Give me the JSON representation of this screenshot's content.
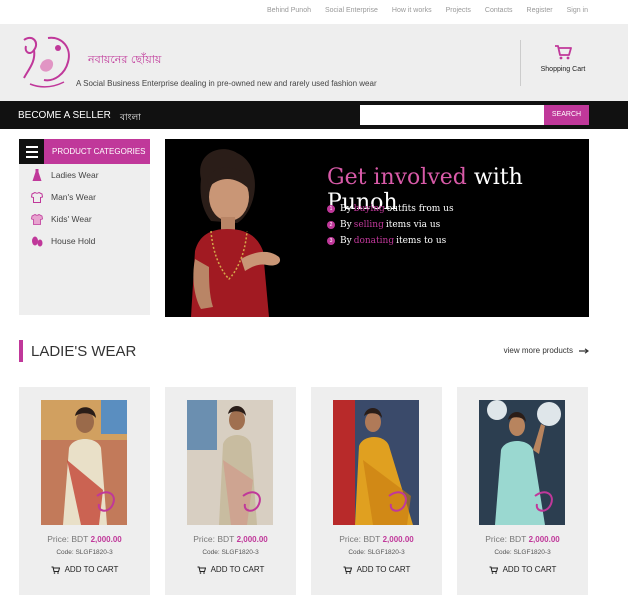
{
  "topnav": [
    "Behind Punoh",
    "Social Enterprise",
    "How it works",
    "Projects",
    "Contacts",
    "Register",
    "Sign in"
  ],
  "header": {
    "logo_text": "নবায়নের ছোঁয়ায়",
    "tagline": "A Social Business Enterprise dealing in pre-owned new and rarely used fashion wear",
    "cart_label": "Shopping Cart"
  },
  "bar": {
    "seller": "BECOME A SELLER",
    "language": "বাংলা",
    "search_value": "",
    "search_button": "SEARCH"
  },
  "categories": {
    "title": "PRODUCT CATEGORIES",
    "items": [
      {
        "label": "Ladies Wear",
        "icon": "dress-icon"
      },
      {
        "label": "Man's Wear",
        "icon": "shirt-icon"
      },
      {
        "label": "Kids' Wear",
        "icon": "kids-shirt-icon"
      },
      {
        "label": "House Hold",
        "icon": "household-icon"
      }
    ]
  },
  "banner": {
    "headline_a": "Get involved",
    "headline_b": "with Punoh",
    "points": [
      {
        "num": "1",
        "pre": "By",
        "hl": "buying",
        "post": "outfits from us"
      },
      {
        "num": "2",
        "pre": "By",
        "hl": "selling",
        "post": "items via us"
      },
      {
        "num": "3",
        "pre": "By",
        "hl": "donating",
        "post": "items to us"
      }
    ]
  },
  "section": {
    "title": "LADIE'S WEAR",
    "more": "view more products"
  },
  "products": [
    {
      "price_label": "Price: BDT",
      "price": "2,000.00",
      "code": "Code: SLGF1820-3",
      "add": "ADD TO CART"
    },
    {
      "price_label": "Price: BDT",
      "price": "2,000.00",
      "code": "Code: SLGF1820-3",
      "add": "ADD TO CART"
    },
    {
      "price_label": "Price: BDT",
      "price": "2,000.00",
      "code": "Code: SLGF1820-3",
      "add": "ADD TO CART"
    },
    {
      "price_label": "Price: BDT",
      "price": "2,000.00",
      "code": "Code: SLGF1820-3",
      "add": "ADD TO CART"
    }
  ],
  "colors": {
    "accent": "#c0389a",
    "dark": "#111111",
    "panel": "#eeeeee"
  }
}
